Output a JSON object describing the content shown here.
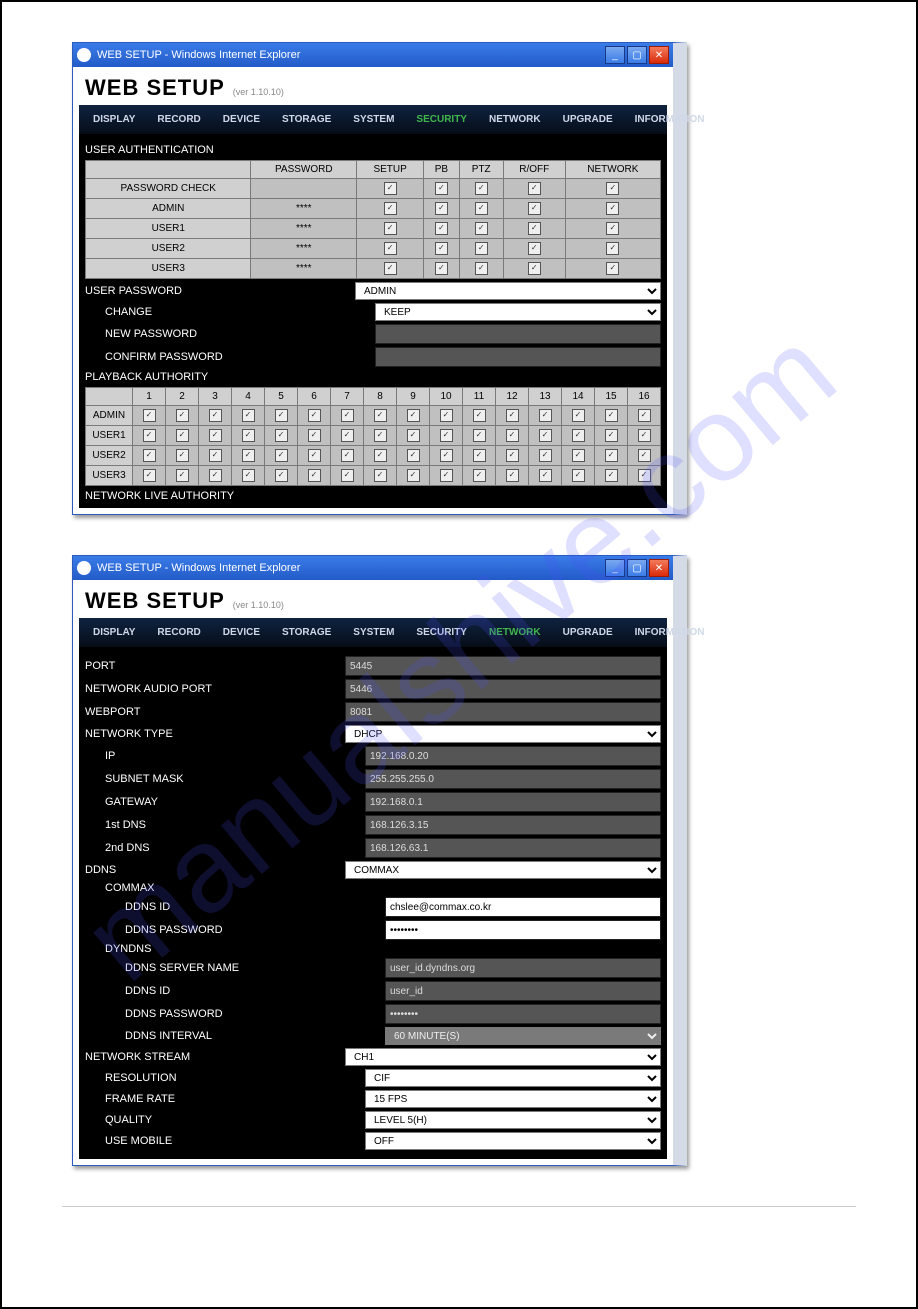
{
  "watermark": "manualshive.com",
  "tabs": [
    "DISPLAY",
    "RECORD",
    "DEVICE",
    "STORAGE",
    "SYSTEM",
    "SECURITY",
    "NETWORK",
    "UPGRADE",
    "INFORMATION"
  ],
  "app": {
    "title": "WEB SETUP",
    "version": "(ver 1.10.10)"
  },
  "win1": {
    "title": "WEB SETUP - Windows Internet Explorer",
    "activeTab": "SECURITY",
    "userAuth": {
      "title": "USER AUTHENTICATION",
      "cols": [
        "PASSWORD",
        "SETUP",
        "PB",
        "PTZ",
        "R/OFF",
        "NETWORK"
      ],
      "rows": [
        {
          "name": "PASSWORD CHECK",
          "password": "",
          "checks": [
            true,
            true,
            true,
            true,
            true
          ]
        },
        {
          "name": "ADMIN",
          "password": "****",
          "checks": [
            true,
            true,
            true,
            true,
            true
          ]
        },
        {
          "name": "USER1",
          "password": "****",
          "checks": [
            true,
            true,
            true,
            true,
            true
          ]
        },
        {
          "name": "USER2",
          "password": "****",
          "checks": [
            true,
            true,
            true,
            true,
            true
          ]
        },
        {
          "name": "USER3",
          "password": "****",
          "checks": [
            true,
            true,
            true,
            true,
            true
          ]
        }
      ]
    },
    "userPassword": {
      "title": "USER PASSWORD",
      "userSelect": "ADMIN",
      "changeLabel": "CHANGE",
      "changeSelect": "KEEP",
      "newPwLabel": "NEW PASSWORD",
      "confirmPwLabel": "CONFIRM PASSWORD"
    },
    "playback": {
      "title": "PLAYBACK AUTHORITY",
      "channels": 16,
      "rows": [
        "ADMIN",
        "USER1",
        "USER2",
        "USER3"
      ]
    },
    "netLive": "NETWORK LIVE AUTHORITY"
  },
  "win2": {
    "title": "WEB SETUP - Windows Internet Explorer",
    "activeTab": "NETWORK",
    "fields": [
      {
        "label": "PORT",
        "value": "5445",
        "type": "gray"
      },
      {
        "label": "NETWORK AUDIO PORT",
        "value": "5446",
        "type": "gray"
      },
      {
        "label": "WEBPORT",
        "value": "8081",
        "type": "gray"
      },
      {
        "label": "NETWORK TYPE",
        "value": "DHCP",
        "type": "select"
      },
      {
        "label": "IP",
        "value": "192.168.0.20",
        "type": "gray",
        "indent": 1
      },
      {
        "label": "SUBNET MASK",
        "value": "255.255.255.0",
        "type": "gray",
        "indent": 1
      },
      {
        "label": "GATEWAY",
        "value": "192.168.0.1",
        "type": "gray",
        "indent": 1
      },
      {
        "label": "1st DNS",
        "value": "168.126.3.15",
        "type": "gray",
        "indent": 1
      },
      {
        "label": "2nd DNS",
        "value": "168.126.63.1",
        "type": "gray",
        "indent": 1
      },
      {
        "label": "DDNS",
        "value": "COMMAX",
        "type": "select"
      },
      {
        "label": "COMMAX",
        "value": "",
        "type": "label",
        "indent": 1
      },
      {
        "label": "DDNS ID",
        "value": "chslee@commax.co.kr",
        "type": "white",
        "indent": 2
      },
      {
        "label": "DDNS PASSWORD",
        "value": "••••••••",
        "type": "white",
        "indent": 2
      },
      {
        "label": "DYNDNS",
        "value": "",
        "type": "label",
        "indent": 1
      },
      {
        "label": "DDNS SERVER NAME",
        "value": "user_id.dyndns.org",
        "type": "gray",
        "indent": 2
      },
      {
        "label": "DDNS ID",
        "value": "user_id",
        "type": "gray",
        "indent": 2
      },
      {
        "label": "DDNS PASSWORD",
        "value": "••••••••",
        "type": "gray",
        "indent": 2
      },
      {
        "label": "DDNS INTERVAL",
        "value": "60 MINUTE(S)",
        "type": "gray-select",
        "indent": 2
      },
      {
        "label": "NETWORK STREAM",
        "value": "CH1",
        "type": "select"
      },
      {
        "label": "RESOLUTION",
        "value": "CIF",
        "type": "select",
        "indent": 1
      },
      {
        "label": "FRAME RATE",
        "value": "15 FPS",
        "type": "select",
        "indent": 1
      },
      {
        "label": "QUALITY",
        "value": "LEVEL 5(H)",
        "type": "select",
        "indent": 1
      },
      {
        "label": "USE MOBILE",
        "value": "OFF",
        "type": "select",
        "indent": 1
      }
    ]
  }
}
